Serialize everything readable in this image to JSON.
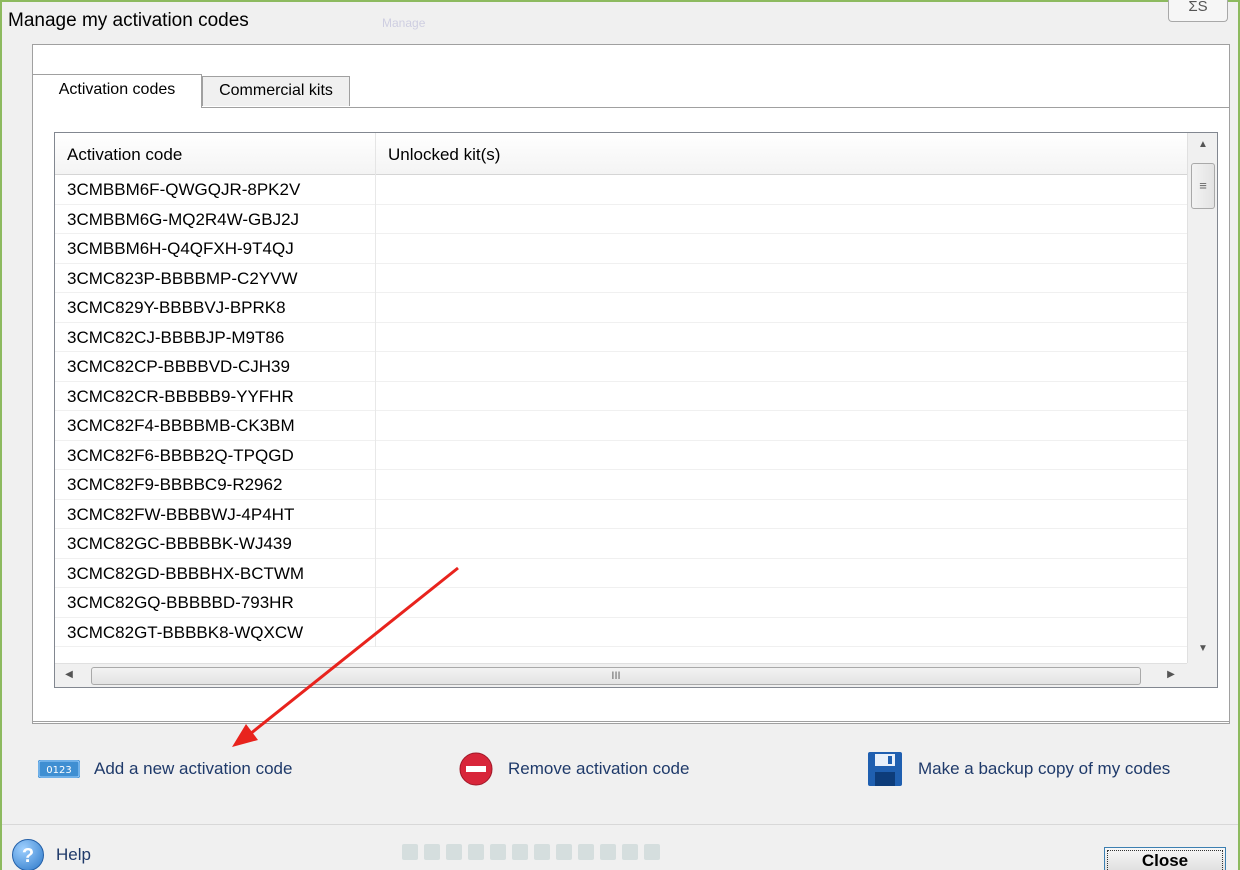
{
  "window": {
    "title": "Manage my activation codes",
    "title_ghost": "Manage",
    "close_glyph": "ΣS"
  },
  "tabs": [
    {
      "label": "Activation codes",
      "active": true
    },
    {
      "label": "Commercial kits",
      "active": false
    }
  ],
  "table": {
    "columns": [
      "Activation code",
      "Unlocked kit(s)"
    ],
    "rows": [
      {
        "code": "3CMBBM6F-QWGQJR-8PK2V",
        "kits": ""
      },
      {
        "code": "3CMBBM6G-MQ2R4W-GBJ2J",
        "kits": ""
      },
      {
        "code": "3CMBBM6H-Q4QFXH-9T4QJ",
        "kits": ""
      },
      {
        "code": "3CMC823P-BBBBMP-C2YVW",
        "kits": ""
      },
      {
        "code": "3CMC829Y-BBBBVJ-BPRK8",
        "kits": ""
      },
      {
        "code": "3CMC82CJ-BBBBJP-M9T86",
        "kits": ""
      },
      {
        "code": "3CMC82CP-BBBBVD-CJH39",
        "kits": ""
      },
      {
        "code": "3CMC82CR-BBBBB9-YYFHR",
        "kits": ""
      },
      {
        "code": "3CMC82F4-BBBBMB-CK3BM",
        "kits": ""
      },
      {
        "code": "3CMC82F6-BBBB2Q-TPQGD",
        "kits": ""
      },
      {
        "code": "3CMC82F9-BBBBC9-R2962",
        "kits": ""
      },
      {
        "code": "3CMC82FW-BBBBWJ-4P4HT",
        "kits": ""
      },
      {
        "code": "3CMC82GC-BBBBBK-WJ439",
        "kits": ""
      },
      {
        "code": "3CMC82GD-BBBBHX-BCTWM",
        "kits": ""
      },
      {
        "code": "3CMC82GQ-BBBBBD-793HR",
        "kits": ""
      },
      {
        "code": "3CMC82GT-BBBBK8-WQXCW",
        "kits": ""
      }
    ],
    "vthumb_glyph": "≡",
    "hthumb_glyph": "III",
    "scroll_up": "▲",
    "scroll_down": "▼",
    "scroll_left": "◀",
    "scroll_right": "▶"
  },
  "actions": {
    "add_label": "Add a new activation code",
    "add_icon_text": "0123",
    "remove_label": "Remove activation code",
    "backup_label": "Make a backup copy of my codes"
  },
  "footer": {
    "help_label": "Help",
    "help_icon_text": "?",
    "close_label": "Close"
  },
  "colors": {
    "arrow": "#e8231d",
    "window_border": "#8dba5f",
    "link_text": "#1f3a6a"
  },
  "icons": {
    "add": "keypad-icon",
    "remove": "minus-circle-icon",
    "backup": "floppy-disk-icon",
    "help": "help-icon"
  }
}
